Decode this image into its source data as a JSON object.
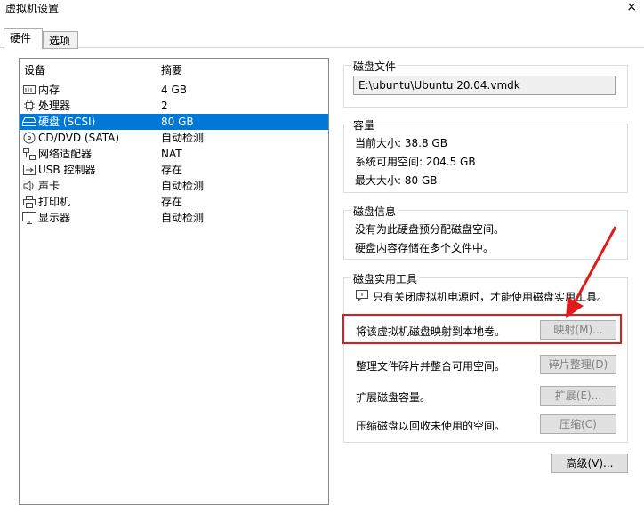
{
  "window": {
    "title": "虚拟机设置",
    "close": "×"
  },
  "tabs": [
    {
      "label": "硬件"
    },
    {
      "label": "选项"
    }
  ],
  "device_list": {
    "header_device": "设备",
    "header_summary": "摘要",
    "rows": [
      {
        "name": "内存",
        "summary": "4 GB",
        "icon": "memory-icon"
      },
      {
        "name": "处理器",
        "summary": "2",
        "icon": "processor-icon"
      },
      {
        "name": "硬盘 (SCSI)",
        "summary": "80 GB",
        "icon": "harddisk-icon"
      },
      {
        "name": "CD/DVD (SATA)",
        "summary": "自动检测",
        "icon": "cdrom-icon"
      },
      {
        "name": "网络适配器",
        "summary": "NAT",
        "icon": "network-icon"
      },
      {
        "name": "USB 控制器",
        "summary": "存在",
        "icon": "usb-icon"
      },
      {
        "name": "声卡",
        "summary": "自动检测",
        "icon": "sound-icon"
      },
      {
        "name": "打印机",
        "summary": "存在",
        "icon": "printer-icon"
      },
      {
        "name": "显示器",
        "summary": "自动检测",
        "icon": "monitor-icon"
      }
    ],
    "selected_index": 2
  },
  "disk_file": {
    "title": "磁盘文件",
    "path": "E:\\ubuntu\\Ubuntu 20.04.vmdk"
  },
  "capacity": {
    "title": "容量",
    "current": "当前大小: 38.8 GB",
    "available": "系统可用空间: 204.5 GB",
    "max": "最大大小: 80 GB"
  },
  "disk_info": {
    "title": "磁盘信息",
    "line1": "没有为此硬盘预分配磁盘空间。",
    "line2": "硬盘内容存储在多个文件中。"
  },
  "utilities": {
    "title": "磁盘实用工具",
    "notice": "只有关闭虚拟机电源时，才能使用磁盘实用工具。",
    "map_text": "将该虚拟机磁盘映射到本地卷。",
    "map_button": "映射(M)...",
    "defrag_text": "整理文件碎片并整合可用空间。",
    "defrag_button": "碎片整理(D)",
    "expand_text": "扩展磁盘容量。",
    "expand_button": "扩展(E)...",
    "compact_text": "压缩磁盘以回收未使用的空间。",
    "compact_button": "压缩(C)"
  },
  "advanced_button": "高级(V)...",
  "colors": {
    "selection": "#0078d7",
    "highlight_red": "#e01b1b"
  }
}
